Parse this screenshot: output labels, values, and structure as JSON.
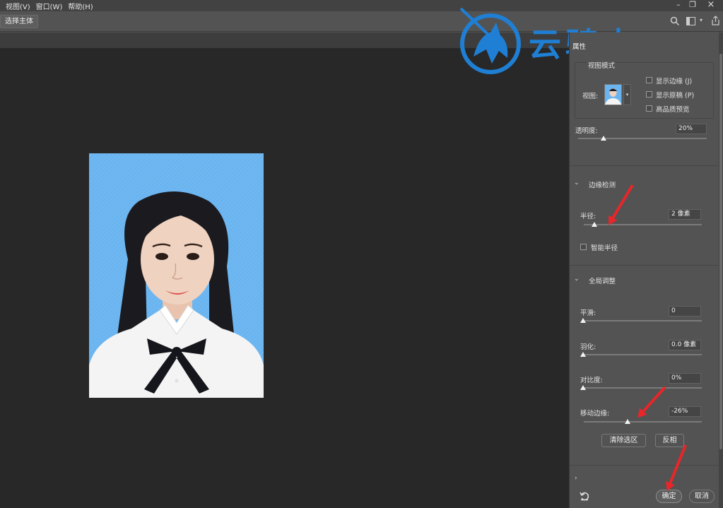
{
  "menubar": {
    "items": [
      "视图(V)",
      "窗口(W)",
      "帮助(H)"
    ]
  },
  "toolbar": {
    "select_subject": "选择主体"
  },
  "watermark": {
    "text": "云骑士"
  },
  "panel": {
    "title": "属性",
    "view_mode": {
      "title": "视图模式",
      "view_label": "视图:",
      "options": [
        "显示边缘 (J)",
        "显示原稿 (P)",
        "高品质预览"
      ]
    },
    "opacity": {
      "label": "透明度:",
      "value": "20%"
    },
    "edge_detection": {
      "title": "边缘检测",
      "radius_label": "半径:",
      "radius_value": "2 像素",
      "smart_radius": "智能半径"
    },
    "global_adjust": {
      "title": "全局调整",
      "smooth_label": "平滑:",
      "smooth_value": "0",
      "feather_label": "羽化:",
      "feather_value": "0.0 像素",
      "contrast_label": "对比度:",
      "contrast_value": "0%",
      "shift_label": "移动边缘:",
      "shift_value": "-26%",
      "clear_button": "清除选区",
      "invert_button": "反相"
    },
    "ok_button": "确定",
    "cancel_button": "取消"
  },
  "colors": {
    "photo_bg": "#6ab4f0",
    "accent_red": "#e8262a",
    "watermark_blue": "#1f7fd4"
  }
}
